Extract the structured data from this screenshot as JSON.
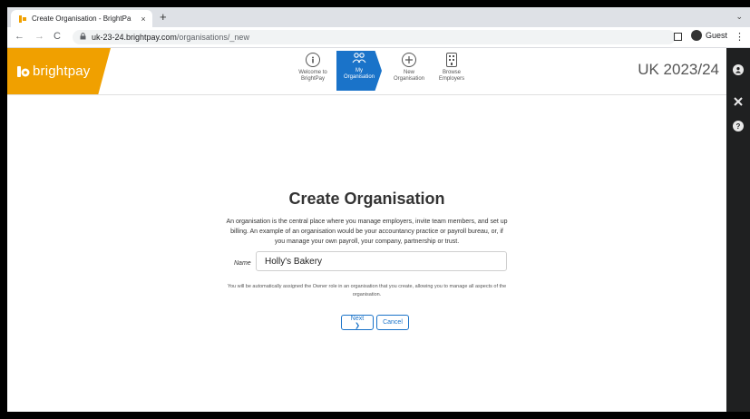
{
  "browser": {
    "tab_title": "Create Organisation - BrightPa",
    "tab_close": "×",
    "new_tab": "+",
    "tab_menu": "⌄",
    "url_host": "uk-23-24.brightpay.com",
    "url_path": "/organisations/_new",
    "back": "←",
    "forward": "→",
    "reload": "C",
    "profile_label": "Guest",
    "menu": "⋮"
  },
  "app": {
    "logo_text": "brightpay",
    "year_label": "UK 2023/24",
    "brand_color": "#f0a000",
    "accent_color": "#1a73c9",
    "steps": [
      {
        "line1": "Welcome to",
        "line2": "BrightPay",
        "icon": "info-icon",
        "active": false
      },
      {
        "line1": "My",
        "line2": "Organisation",
        "icon": "people-icon",
        "active": true
      },
      {
        "line1": "New",
        "line2": "Organisation",
        "icon": "plus-icon",
        "active": false
      },
      {
        "line1": "Browse",
        "line2": "Employers",
        "icon": "building-icon",
        "active": false
      }
    ],
    "right_icons": [
      "user-icon",
      "tools-icon",
      "help-icon"
    ]
  },
  "form": {
    "title": "Create Organisation",
    "description": "An organisation is the central place where you manage employers, invite team members, and set up billing. An example of an organisation would be your accountancy practice or payroll bureau, or, if you manage your own payroll, your company, partnership or trust.",
    "name_label": "Name",
    "name_value": "Holly's Bakery",
    "note": "You will be automatically assigned the Owner role in an organisation that you create, allowing you to manage all aspects of the organisation.",
    "next_label": "Next ❯",
    "cancel_label": "Cancel"
  }
}
